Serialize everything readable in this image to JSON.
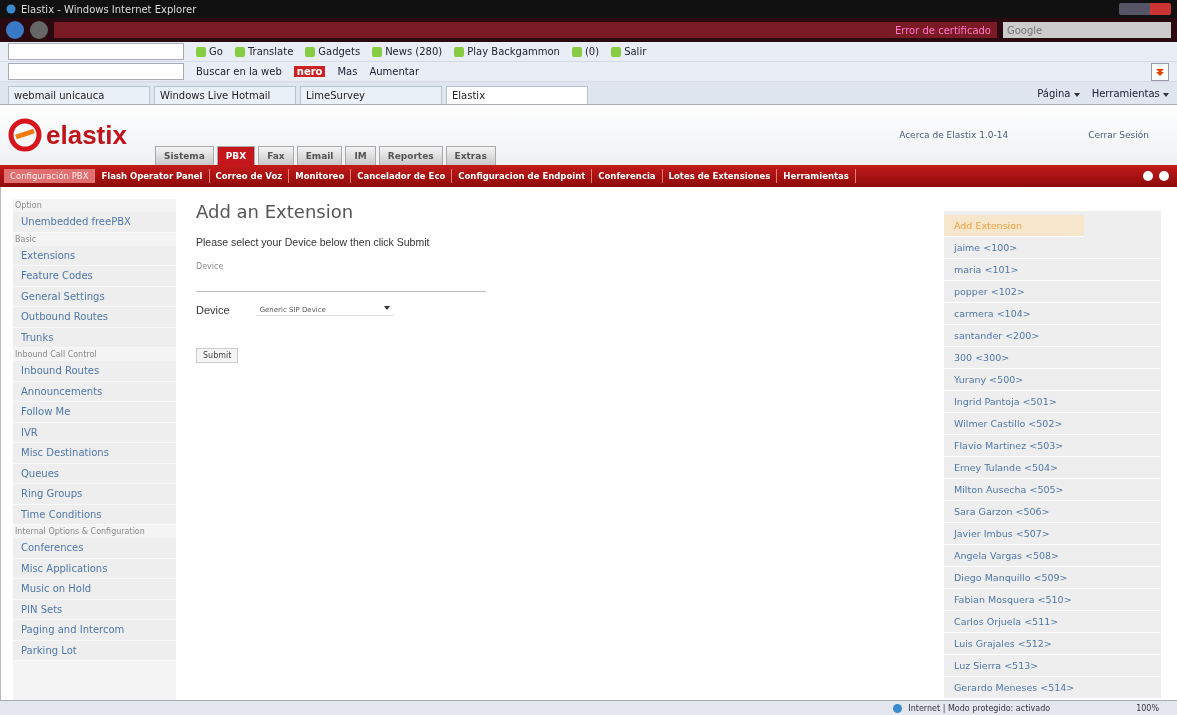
{
  "window": {
    "title": "Elastix - Windows Internet Explorer"
  },
  "address_bar": {
    "certificate": "Error de certificado",
    "search_placeholder": "Google"
  },
  "toolbar_1": [
    "Go",
    "Translate",
    "Gadgets",
    "News (280)",
    "Play Backgammon",
    "(0)",
    "Salir"
  ],
  "toolbar_2": [
    "Buscar en la web",
    "nero",
    "Mas",
    "Aumentar"
  ],
  "favorites_tabs": [
    {
      "label": "webmail unicauca",
      "selected": false
    },
    {
      "label": "Windows Live Hotmail",
      "selected": false
    },
    {
      "label": "LimeSurvey",
      "selected": false
    },
    {
      "label": "Elastix",
      "selected": true
    }
  ],
  "command_bar": [
    "Página",
    "Herramientas"
  ],
  "elastix": {
    "logo": "elastix",
    "about": "Acerca de Elastix 1.0-14",
    "logout": "Cerrar Sesión",
    "tabs": [
      {
        "label": "Sistema",
        "selected": false
      },
      {
        "label": "PBX",
        "selected": true
      },
      {
        "label": "Fax",
        "selected": false
      },
      {
        "label": "Email",
        "selected": false
      },
      {
        "label": "IM",
        "selected": false
      },
      {
        "label": "Reportes",
        "selected": false
      },
      {
        "label": "Extras",
        "selected": false
      }
    ],
    "submenu": [
      {
        "label": "Configuración PBX",
        "selected": true
      },
      {
        "label": "Flash Operator Panel",
        "selected": false
      },
      {
        "label": "Correo de Voz",
        "selected": false
      },
      {
        "label": "Monitoreo",
        "selected": false
      },
      {
        "label": "Cancelador de Eco",
        "selected": false
      },
      {
        "label": "Configuracion de Endpoint",
        "selected": false
      },
      {
        "label": "Conferencia",
        "selected": false
      },
      {
        "label": "Lotes de Extensiones",
        "selected": false
      },
      {
        "label": "Herramientas",
        "selected": false
      }
    ]
  },
  "sidebar": [
    {
      "header": "Option",
      "items": [
        "Unembedded freePBX"
      ]
    },
    {
      "header": "Basic",
      "items": [
        "Extensions",
        "Feature Codes",
        "General Settings",
        "Outbound Routes",
        "Trunks"
      ]
    },
    {
      "header": "Inbound Call Control",
      "items": [
        "Inbound Routes",
        "Announcements",
        "Follow Me",
        "IVR",
        "Misc Destinations",
        "Queues",
        "Ring Groups",
        "Time Conditions"
      ]
    },
    {
      "header": "Internal Options & Configuration",
      "items": [
        "Conferences",
        "Misc Applications",
        "Music on Hold",
        "PIN Sets",
        "Paging and Intercom",
        "Parking Lot"
      ]
    }
  ],
  "form": {
    "title": "Add an Extension",
    "instruction": "Please select your Device below then click Submit",
    "section": "Device",
    "field_label": "Device",
    "device_value": "Generic SIP Device",
    "submit": "Submit"
  },
  "extensions": [
    {
      "label": "Add Extension",
      "selected": true
    },
    {
      "label": "jaime <100>",
      "selected": false
    },
    {
      "label": "maria <101>",
      "selected": false
    },
    {
      "label": "popper <102>",
      "selected": false
    },
    {
      "label": "carmera <104>",
      "selected": false
    },
    {
      "label": "santander <200>",
      "selected": false
    },
    {
      "label": "300 <300>",
      "selected": false
    },
    {
      "label": "Yurany <500>",
      "selected": false
    },
    {
      "label": "Ingrid Pantoja <501>",
      "selected": false
    },
    {
      "label": "Wilmer Castillo <502>",
      "selected": false
    },
    {
      "label": "Flavio Martinez <503>",
      "selected": false
    },
    {
      "label": "Erney Tulande <504>",
      "selected": false
    },
    {
      "label": "Milton Ausecha <505>",
      "selected": false
    },
    {
      "label": "Sara Garzon <506>",
      "selected": false
    },
    {
      "label": "Javier Imbus <507>",
      "selected": false
    },
    {
      "label": "Angela Vargas <508>",
      "selected": false
    },
    {
      "label": "Diego Manquillo <509>",
      "selected": false
    },
    {
      "label": "Fabian Mosquera <510>",
      "selected": false
    },
    {
      "label": "Carlos Orjuela <511>",
      "selected": false
    },
    {
      "label": "Luis Grajales <512>",
      "selected": false
    },
    {
      "label": "Luz Sierra <513>",
      "selected": false
    },
    {
      "label": "Gerardo Meneses <514>",
      "selected": false
    }
  ],
  "status_bar": {
    "zone": "Internet | Modo protegido: activado",
    "zoom": "100%"
  }
}
